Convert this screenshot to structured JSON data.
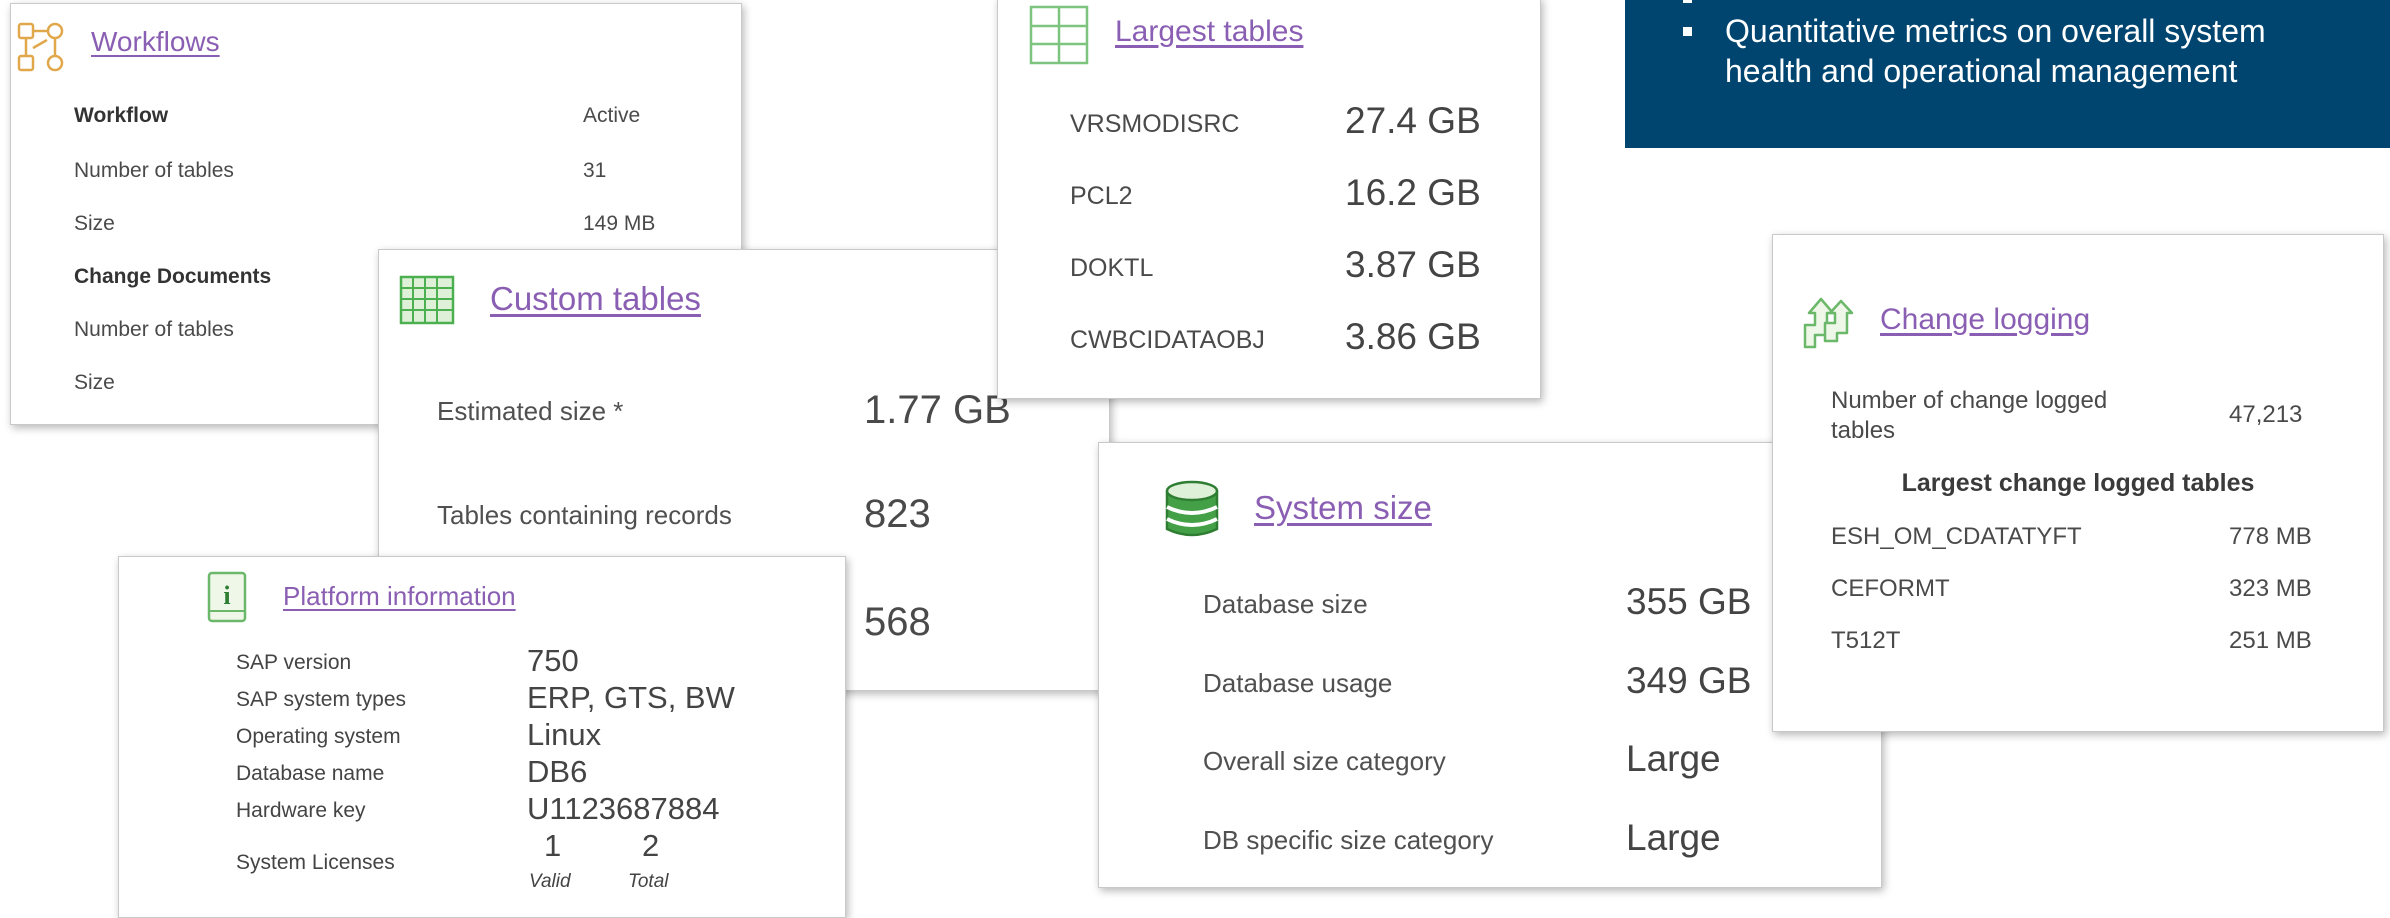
{
  "workflows": {
    "title": "Workflows",
    "rows": [
      {
        "label": "Workflow",
        "value": "Active"
      },
      {
        "label": "Number of tables",
        "value": "31"
      },
      {
        "label": "Size",
        "value": "149 MB"
      },
      {
        "label": "Change Documents",
        "value": ""
      },
      {
        "label": "Number of tables",
        "value": ""
      },
      {
        "label": "Size",
        "value": ""
      }
    ],
    "icon": "workflow-icon",
    "accent": "#e8a849"
  },
  "custom_tables": {
    "title": "Custom tables",
    "rows": [
      {
        "label": "Estimated size *",
        "value": "1.77 GB"
      },
      {
        "label": "Tables containing records",
        "value": "823"
      },
      {
        "label": "",
        "value": "568"
      }
    ],
    "icon": "grid-table-icon",
    "accent": "#4caf50"
  },
  "largest_tables": {
    "title": "Largest tables",
    "rows": [
      {
        "label": "VRSMODISRC",
        "value": "27.4 GB"
      },
      {
        "label": "PCL2",
        "value": "16.2 GB"
      },
      {
        "label": "DOKTL",
        "value": "3.87 GB"
      },
      {
        "label": "CWBCIDATAOBJ",
        "value": "3.86 GB"
      }
    ],
    "icon": "table-icon"
  },
  "platform": {
    "title": "Platform information",
    "rows": [
      {
        "label": "SAP version",
        "value": "750"
      },
      {
        "label": "SAP system types",
        "value": "ERP, GTS, BW"
      },
      {
        "label": "Operating system",
        "value": "Linux"
      },
      {
        "label": "Database name",
        "value": "DB6"
      },
      {
        "label": "Hardware key",
        "value": "U1123687884"
      }
    ],
    "licenses": {
      "label": "System Licenses",
      "valid": "1",
      "total": "2",
      "valid_label": "Valid",
      "total_label": "Total"
    },
    "icon": "info-icon"
  },
  "system_size": {
    "title": "System size",
    "rows": [
      {
        "label": "Database size",
        "value": "355 GB"
      },
      {
        "label": "Database usage",
        "value": "349 GB"
      },
      {
        "label": "Overall size category",
        "value": "Large"
      },
      {
        "label": "DB specific size category",
        "value": "Large"
      }
    ],
    "icon": "database-icon"
  },
  "change_logging": {
    "title": "Change logging",
    "count_label_1": "Number of change logged",
    "count_label_2": "tables",
    "count_value": "47,213",
    "subheading": "Largest change logged tables",
    "rows": [
      {
        "label": "ESH_OM_CDATATYFT",
        "value": "778 MB"
      },
      {
        "label": "CEFORMT",
        "value": "323 MB"
      },
      {
        "label": "T512T",
        "value": "251 MB"
      }
    ],
    "icon": "change-arrows-icon"
  },
  "banner": {
    "line1": "Quantitative metrics on overall system",
    "line2": "health and operational management",
    "bg_color": "#004570"
  }
}
